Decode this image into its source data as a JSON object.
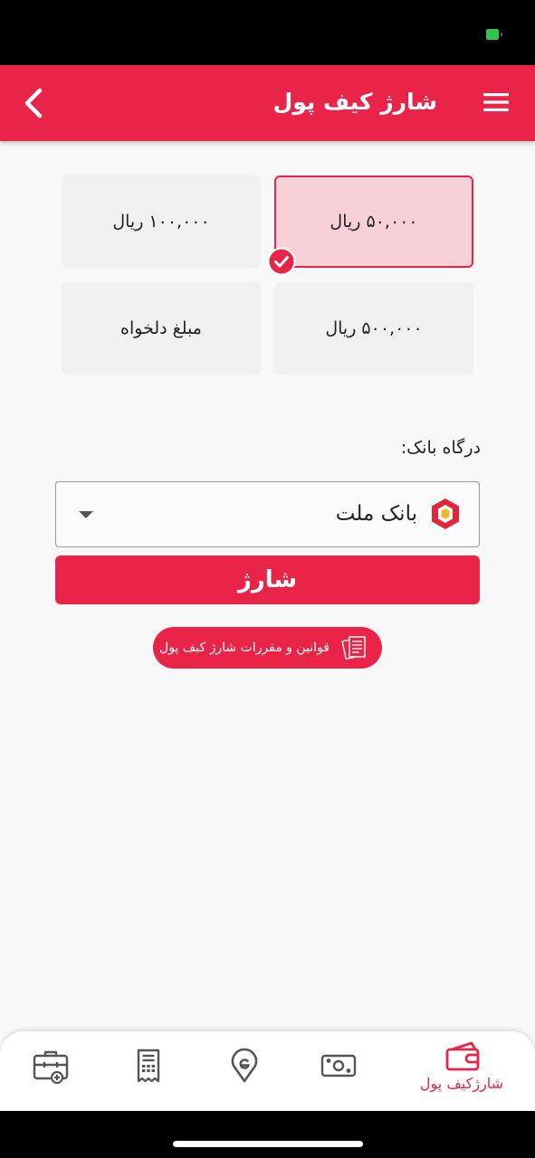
{
  "header": {
    "title": "شارژ کیف پول"
  },
  "amounts": [
    {
      "label": "۵۰,۰۰۰ ریال",
      "selected": true
    },
    {
      "label": "۱۰۰,۰۰۰ ریال",
      "selected": false
    },
    {
      "label": "۵۰۰,۰۰۰ ریال",
      "selected": false
    },
    {
      "label": "مبلغ دلخواه",
      "selected": false
    }
  ],
  "bank": {
    "label": "درگاه بانک:",
    "selected": "بانک ملت"
  },
  "charge_button": "شارژ",
  "rules_button": "قوانین و مقررات شارژ کیف پول",
  "bottom_nav": {
    "active_label": "شارژکیف پول",
    "icons": [
      "wallet-icon",
      "cash-icon",
      "location-pin-icon",
      "receipt-icon",
      "briefcase-add-icon"
    ]
  },
  "colors": {
    "accent": "#ea2448",
    "selected_bg": "#f8d0d8",
    "card_bg": "#f0f0f0"
  }
}
